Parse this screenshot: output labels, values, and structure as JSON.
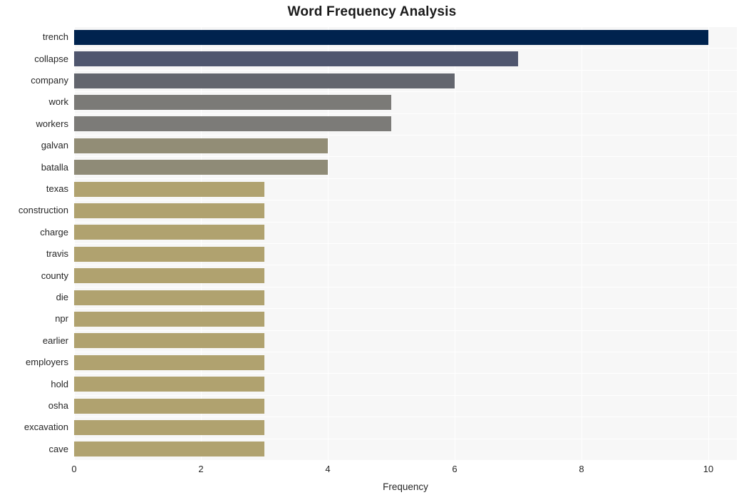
{
  "chart_data": {
    "type": "bar",
    "orientation": "horizontal",
    "title": "Word Frequency Analysis",
    "xlabel": "Frequency",
    "ylabel": "",
    "xlim": [
      0,
      10.45
    ],
    "xticks": [
      0,
      2,
      4,
      6,
      8,
      10
    ],
    "xtick_labels": [
      "0",
      "2",
      "4",
      "6",
      "8",
      "10"
    ],
    "grid": true,
    "grid_color": "#ffffff",
    "plot_background": "#f7f7f7",
    "figure_background": "#ffffff",
    "legend": null,
    "categories": [
      "trench",
      "collapse",
      "company",
      "work",
      "workers",
      "galvan",
      "batalla",
      "texas",
      "construction",
      "charge",
      "travis",
      "county",
      "die",
      "npr",
      "earlier",
      "employers",
      "hold",
      "osha",
      "excavation",
      "cave"
    ],
    "values": [
      10,
      7,
      6,
      5,
      5,
      4,
      4,
      3,
      3,
      3,
      3,
      3,
      3,
      3,
      3,
      3,
      3,
      3,
      3,
      3
    ],
    "bar_colors": [
      "#00234e",
      "#4f566e",
      "#63666e",
      "#7b7a77",
      "#7c7b78",
      "#928d76",
      "#8f8b77",
      "#b0a26f",
      "#b0a26f",
      "#b0a26f",
      "#b0a26f",
      "#b0a26f",
      "#b0a26f",
      "#b0a26f",
      "#b0a26f",
      "#b0a26f",
      "#b0a26f",
      "#b0a26f",
      "#b0a26f",
      "#b0a26f"
    ]
  }
}
